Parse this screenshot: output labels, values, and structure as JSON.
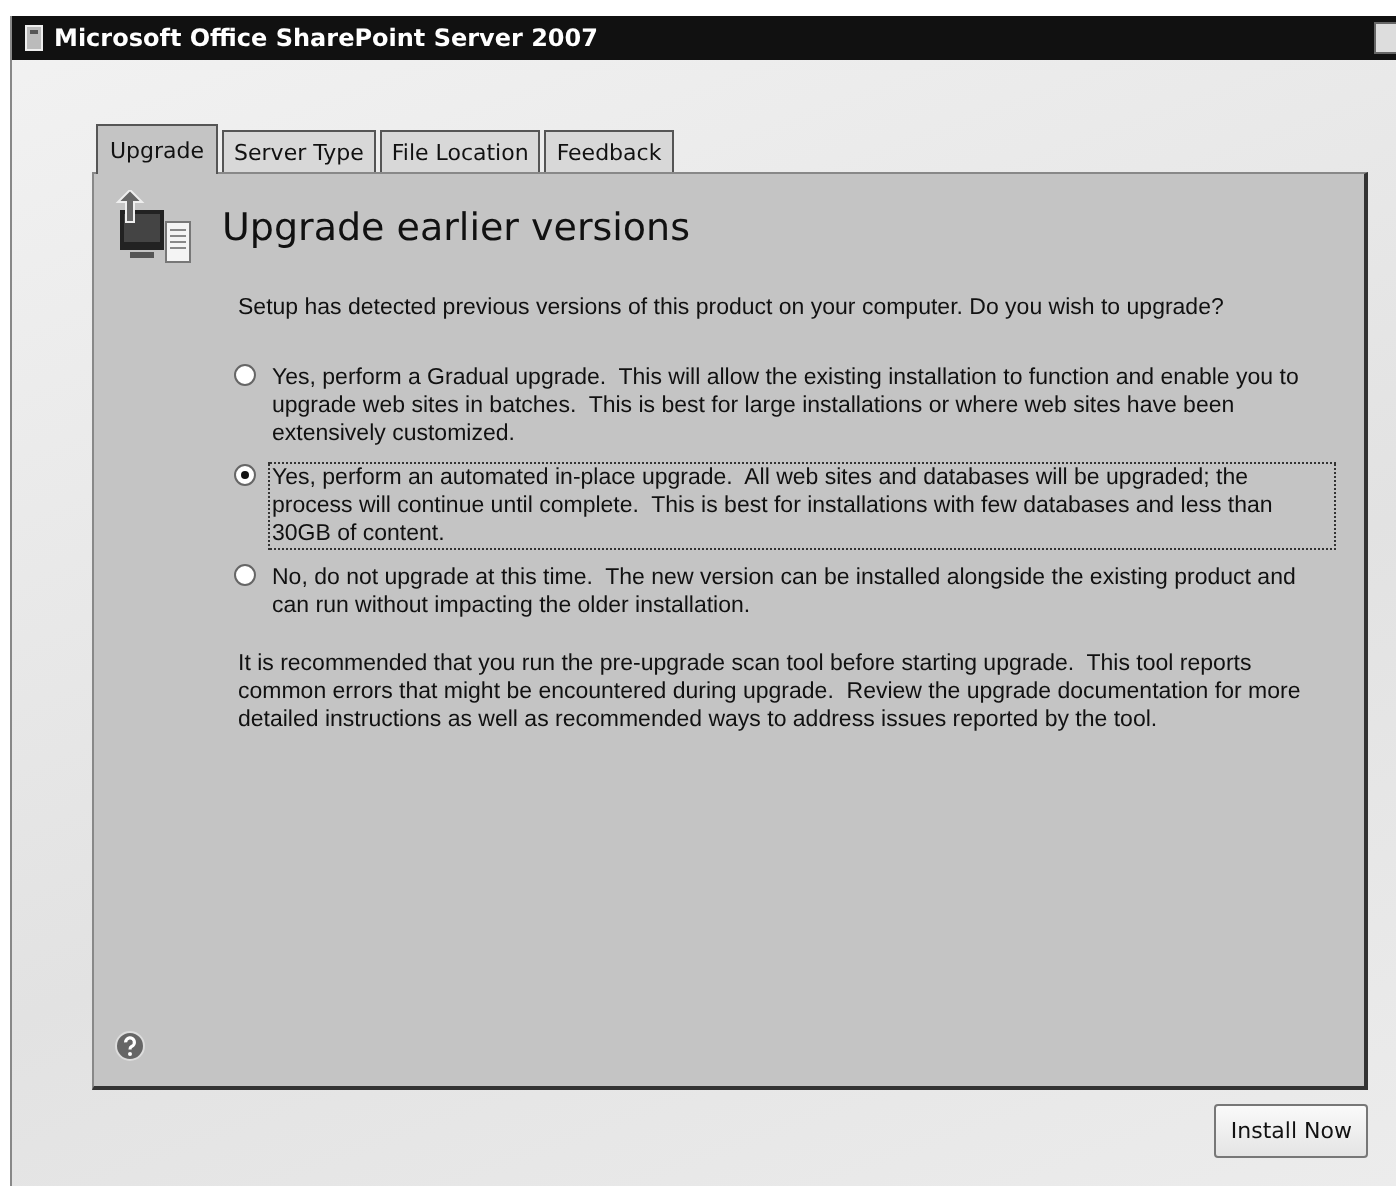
{
  "window": {
    "title": "Microsoft Office SharePoint Server 2007"
  },
  "tabs": [
    {
      "label": "Upgrade",
      "selected": true
    },
    {
      "label": "Server Type",
      "selected": false
    },
    {
      "label": "File Location",
      "selected": false
    },
    {
      "label": "Feedback",
      "selected": false
    }
  ],
  "heading": "Upgrade earlier versions",
  "intro": "Setup has detected previous versions of this product on your computer.  Do you wish to upgrade?",
  "options": [
    {
      "label": "Yes, perform a Gradual upgrade.  This will allow the existing installation to function and enable you to upgrade web sites in batches.  This is best for large installations or where web sites have been extensively customized.",
      "selected": false
    },
    {
      "label": "Yes, perform an automated in-place upgrade.  All web sites and databases will be upgraded; the process will continue until complete.  This is best for installations with few databases and less than 30GB of content.",
      "selected": true
    },
    {
      "label": "No, do not upgrade at this time.  The new version can be installed alongside the existing product and can run without impacting the older installation.",
      "selected": false
    }
  ],
  "note": "It is recommended that you run the pre-upgrade scan tool before starting upgrade.  This tool reports common errors that might be encountered during upgrade.  Review the upgrade documentation for more detailed instructions as well as recommended ways to address issues reported by the tool.",
  "buttons": [
    "Install Now"
  ]
}
